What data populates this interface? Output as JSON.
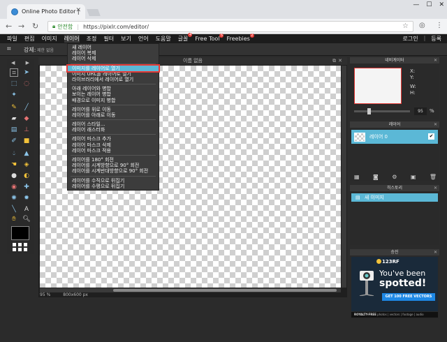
{
  "browser": {
    "tab_title": "Online Photo Editor |",
    "secure_label": "안전함",
    "url": "https://pixlr.com/editor/"
  },
  "menubar": {
    "items": [
      {
        "label": "파일",
        "badge": ""
      },
      {
        "label": "편집",
        "badge": ""
      },
      {
        "label": "이미지",
        "badge": ""
      },
      {
        "label": "레이어",
        "badge": ""
      },
      {
        "label": "조정",
        "badge": ""
      },
      {
        "label": "필터",
        "badge": ""
      },
      {
        "label": "보기",
        "badge": ""
      },
      {
        "label": "언어",
        "badge": ""
      },
      {
        "label": "도움말",
        "badge": ""
      },
      {
        "label": "글꼴",
        "badge": "4"
      },
      {
        "label": "Free Tool",
        "badge": "5"
      },
      {
        "label": "Freebies",
        "badge": "2"
      }
    ],
    "login": "로그인",
    "register": "등록"
  },
  "options": {
    "strength_label": "강제:",
    "strength_value": "제한 없음"
  },
  "canvas": {
    "title": "이름 없음",
    "zoom": "95",
    "zoom_unit": "%",
    "dimensions": "800x600 px"
  },
  "navigator": {
    "title": "네비게이터",
    "x": "X:",
    "y": "Y:",
    "w": "W:",
    "h": "H:",
    "zoom": "95",
    "zoom_unit": "%",
    "zoom_level": 0.25
  },
  "layers_panel": {
    "title": "레이어",
    "layer_name": "레이어 0"
  },
  "history_panel": {
    "title": "히스토리",
    "entry": "새 이미지"
  },
  "ad_panel": {
    "title": "승진",
    "brand": "123RF",
    "headline1": "You've been",
    "headline2": "spotted!",
    "cta": "GET 100 FREE VECTORS",
    "footer_bold": "ROYALTY-FREE",
    "footer": "photos | vectors | footage | audio"
  },
  "layer_menu": {
    "groups": [
      [
        "새 레이어",
        "레이어 복제",
        "레이어 삭제"
      ],
      [
        "이미지를 레이어로 열기",
        "이미지 URL을 레이어로 열기",
        "라이브러리에서 레이어로 열기"
      ],
      [
        "아래 레이어와 병합",
        "보이는 레이어 병합",
        "배경으로 이미지 병합"
      ],
      [
        "레이어를 위로 이동",
        "레이어를 아래로 이동"
      ],
      [
        "레이어 스타일...",
        "레이어 래스터화"
      ],
      [
        "레이어 마스크 추가",
        "레이어 마스크 삭제",
        "레이어 마스크 적용"
      ],
      [
        "레이어를 180° 회전",
        "레이어를 시계방향으로 90° 회전",
        "레이어를 시계반대방향으로 90° 회전"
      ],
      [
        "레이어를 수직으로 뒤집기",
        "레이어를 수평으로 뒤집기"
      ]
    ],
    "highlighted": "이미지를 레이어로 열기"
  }
}
